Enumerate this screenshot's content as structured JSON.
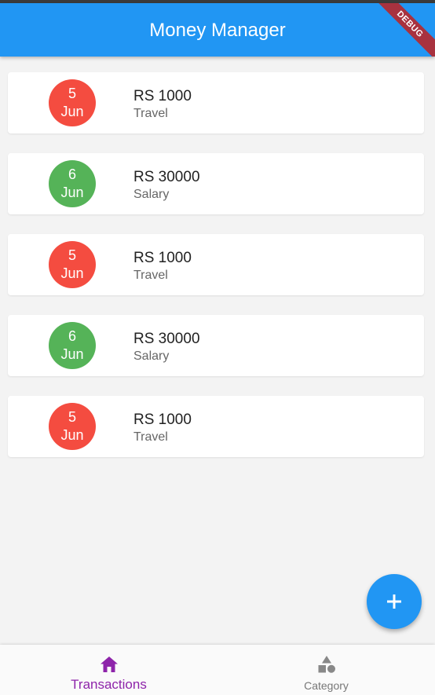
{
  "app_bar": {
    "title": "Money Manager",
    "debug_label": "DEBUG"
  },
  "transactions": [
    {
      "day": "5",
      "month": "Jun",
      "amount": "RS 1000",
      "category": "Travel",
      "kind": "expense"
    },
    {
      "day": "6",
      "month": "Jun",
      "amount": "RS 30000",
      "category": "Salary",
      "kind": "income"
    },
    {
      "day": "5",
      "month": "Jun",
      "amount": "RS 1000",
      "category": "Travel",
      "kind": "expense"
    },
    {
      "day": "6",
      "month": "Jun",
      "amount": "RS 30000",
      "category": "Salary",
      "kind": "income"
    },
    {
      "day": "5",
      "month": "Jun",
      "amount": "RS 1000",
      "category": "Travel",
      "kind": "expense"
    }
  ],
  "fab": {
    "icon": "add-icon"
  },
  "bottom_nav": {
    "items": [
      {
        "label": "Transactions",
        "icon": "home-icon",
        "active": true
      },
      {
        "label": "Category",
        "icon": "category-icon",
        "active": false
      }
    ]
  },
  "colors": {
    "primary": "#2196f3",
    "expense": "#f44336",
    "income": "#4caf50",
    "nav_active": "#8e24aa",
    "debug_banner": "#a8323f"
  }
}
